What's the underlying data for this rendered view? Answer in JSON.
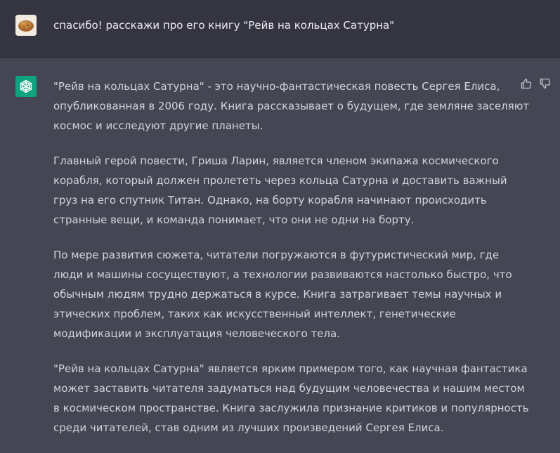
{
  "user_message": {
    "avatar": "user-photo-avatar",
    "text": "спасибо! расскажи про его книгу \"Рейв на кольцах Сатурна\""
  },
  "assistant_message": {
    "avatar": "chatgpt-logo-icon",
    "paragraphs": [
      "\"Рейв на кольцах Сатурна\" - это научно-фантастическая повесть Сергея Елиса, опубликованная в 2006 году. Книга рассказывает о будущем, где земляне заселяют космос и исследуют другие планеты.",
      "Главный герой повести, Гриша Ларин, является членом экипажа космического корабля, который должен пролететь через кольца Сатурна и доставить важный груз на его спутник Титан. Однако, на борту корабля начинают происходить странные вещи, и команда понимает, что они не одни на борту.",
      "По мере развития сюжета, читатели погружаются в футуристический мир, где люди и машины сосуществуют, а технологии развиваются настолько быстро, что обычным людям трудно держаться в курсе. Книга затрагивает темы научных и этических проблем, таких как искусственный интеллект, генетические модификации и эксплуатация человеческого тела.",
      "\"Рейв на кольцах Сатурна\" является ярким примером того, как научная фантастика может заставить читателя задуматься над будущим человечества и нашим местом в космическом пространстве. Книга заслужила признание критиков и популярность среди читателей, став одним из лучших произведений Сергея Елиса."
    ],
    "actions": [
      "thumbs-up-icon",
      "thumbs-down-icon"
    ]
  },
  "colors": {
    "user_row_bg": "#343541",
    "assistant_row_bg": "#444654",
    "text": "#d1d5db",
    "brand_green": "#10a37f"
  }
}
